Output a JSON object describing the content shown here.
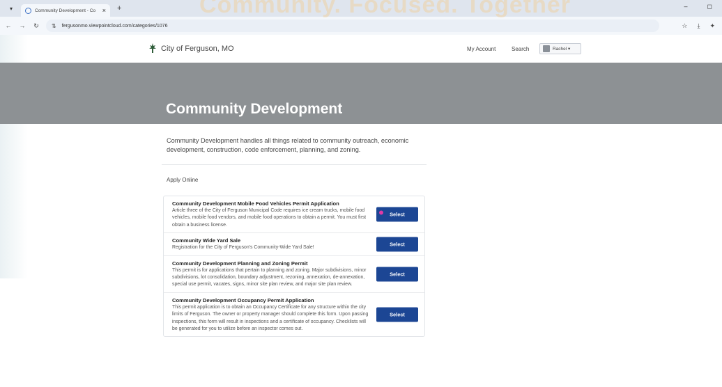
{
  "browser": {
    "tab_title": "Community Development - Co",
    "tab_close": "×",
    "new_tab": "+",
    "url": "fergusonmo.viewpointcloud.com/categories/1076",
    "win_min": "–",
    "win_max": "◻"
  },
  "header": {
    "site_title": "City of Ferguson, MO",
    "my_account": "My Account",
    "search": "Search",
    "user_name": "Rachel ▾"
  },
  "hero": {
    "title": "Community Development",
    "ghost_text": "Community. Focused. Together"
  },
  "intro": {
    "description": "Community Development handles all things related to community outreach, economic development, construction, code enforcement, planning, and zoning."
  },
  "section": {
    "label": "Apply Online"
  },
  "items": [
    {
      "title": "Community Development Mobile Food Vehicles Permit Application",
      "description": "Article three of the City of Ferguson Municipal Code requires ice cream trucks, mobile food vehicles, mobile food vendors, and mobile food operations to obtain a permit. You must first obtain a business license.",
      "button": "Select"
    },
    {
      "title": "Community Wide Yard Sale",
      "description": "Registration for the City of Ferguson's Community-Wide Yard Sale!",
      "button": "Select"
    },
    {
      "title": "Community Development Planning and Zoning Permit",
      "description": "This permit is for applications that pertain to planning and zoning. Major subdivisions, minor subdivisions, lot consolidation, boundary adjustment, rezoning, annexation, de-annexation, special use permit, vacates, signs, minor site plan review, and major site plan review.",
      "button": "Select"
    },
    {
      "title": "Community Development Occupancy Permit Application",
      "description": "This permit application is to obtain an Occupancy Certificate for any structure within the city limits of Ferguson. The owner or property manager should complete this form. Upon passing inspections, this form will result in inspections and a certificate of occupancy. Checklists will be generated for you to utilize before an inspector comes out.",
      "button": "Select"
    }
  ],
  "colors": {
    "hero_bg": "#8d9194",
    "button_bg": "#1c4694",
    "cursor_dot": "#e03aa6"
  }
}
